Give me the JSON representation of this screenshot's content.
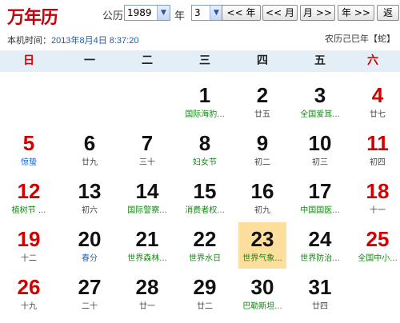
{
  "brand": "万年历",
  "controls": {
    "gregorian_label": "公历",
    "year_value": "1989",
    "year_suffix": "年",
    "month_value": "3",
    "month_suffix": "月",
    "buttons": [
      "<< 年",
      "<< 月",
      "月 >>",
      "年 >>",
      "返"
    ]
  },
  "time": {
    "label": "本机时间：",
    "value": "2013年8月4日 8:37:20"
  },
  "lunar_year": "农历己巳年【蛇】",
  "weekdays": [
    {
      "label": "日",
      "weekend": true
    },
    {
      "label": "一",
      "weekend": false
    },
    {
      "label": "二",
      "weekend": false
    },
    {
      "label": "三",
      "weekend": false
    },
    {
      "label": "四",
      "weekend": false
    },
    {
      "label": "五",
      "weekend": false
    },
    {
      "label": "六",
      "weekend": true
    }
  ],
  "days": [
    {
      "day": "1",
      "sub": "国际海豹...",
      "kind": "festival"
    },
    {
      "day": "2",
      "sub": "廿五",
      "kind": "lunar"
    },
    {
      "day": "3",
      "sub": "全国爱耳...",
      "kind": "festival"
    },
    {
      "day": "4",
      "sub": "廿七",
      "kind": "lunar"
    },
    {
      "day": "5",
      "sub": "惊蛰",
      "kind": "term"
    },
    {
      "day": "6",
      "sub": "廿九",
      "kind": "lunar"
    },
    {
      "day": "7",
      "sub": "三十",
      "kind": "lunar"
    },
    {
      "day": "8",
      "sub": "妇女节",
      "kind": "festival"
    },
    {
      "day": "9",
      "sub": "初二",
      "kind": "lunar"
    },
    {
      "day": "10",
      "sub": "初三",
      "kind": "lunar"
    },
    {
      "day": "11",
      "sub": "初四",
      "kind": "lunar"
    },
    {
      "day": "12",
      "sub": "植树节 ...",
      "kind": "festival"
    },
    {
      "day": "13",
      "sub": "初六",
      "kind": "lunar"
    },
    {
      "day": "14",
      "sub": "国际警察...",
      "kind": "festival"
    },
    {
      "day": "15",
      "sub": "消费者权...",
      "kind": "festival"
    },
    {
      "day": "16",
      "sub": "初九",
      "kind": "lunar"
    },
    {
      "day": "17",
      "sub": "中国国医...",
      "kind": "festival"
    },
    {
      "day": "18",
      "sub": "十一",
      "kind": "lunar"
    },
    {
      "day": "19",
      "sub": "十二",
      "kind": "lunar"
    },
    {
      "day": "20",
      "sub": "春分",
      "kind": "term"
    },
    {
      "day": "21",
      "sub": "世界森林...",
      "kind": "festival"
    },
    {
      "day": "22",
      "sub": "世界水日",
      "kind": "festival"
    },
    {
      "day": "23",
      "sub": "世界气象...",
      "kind": "festival",
      "today": true
    },
    {
      "day": "24",
      "sub": "世界防治...",
      "kind": "festival"
    },
    {
      "day": "25",
      "sub": "全国中小...",
      "kind": "festival"
    },
    {
      "day": "26",
      "sub": "十九",
      "kind": "lunar"
    },
    {
      "day": "27",
      "sub": "二十",
      "kind": "lunar"
    },
    {
      "day": "28",
      "sub": "廿一",
      "kind": "lunar"
    },
    {
      "day": "29",
      "sub": "廿二",
      "kind": "lunar"
    },
    {
      "day": "30",
      "sub": "巴勒斯坦...",
      "kind": "festival"
    },
    {
      "day": "31",
      "sub": "廿四",
      "kind": "lunar"
    }
  ],
  "first_weekday": 3,
  "colors": {
    "weekend_red": "#d40000",
    "festival_green": "#118a11",
    "solar_term_blue": "#1d62c9",
    "today_highlight": "#fcdf9c",
    "weekday_bar": "#e4eef7"
  }
}
